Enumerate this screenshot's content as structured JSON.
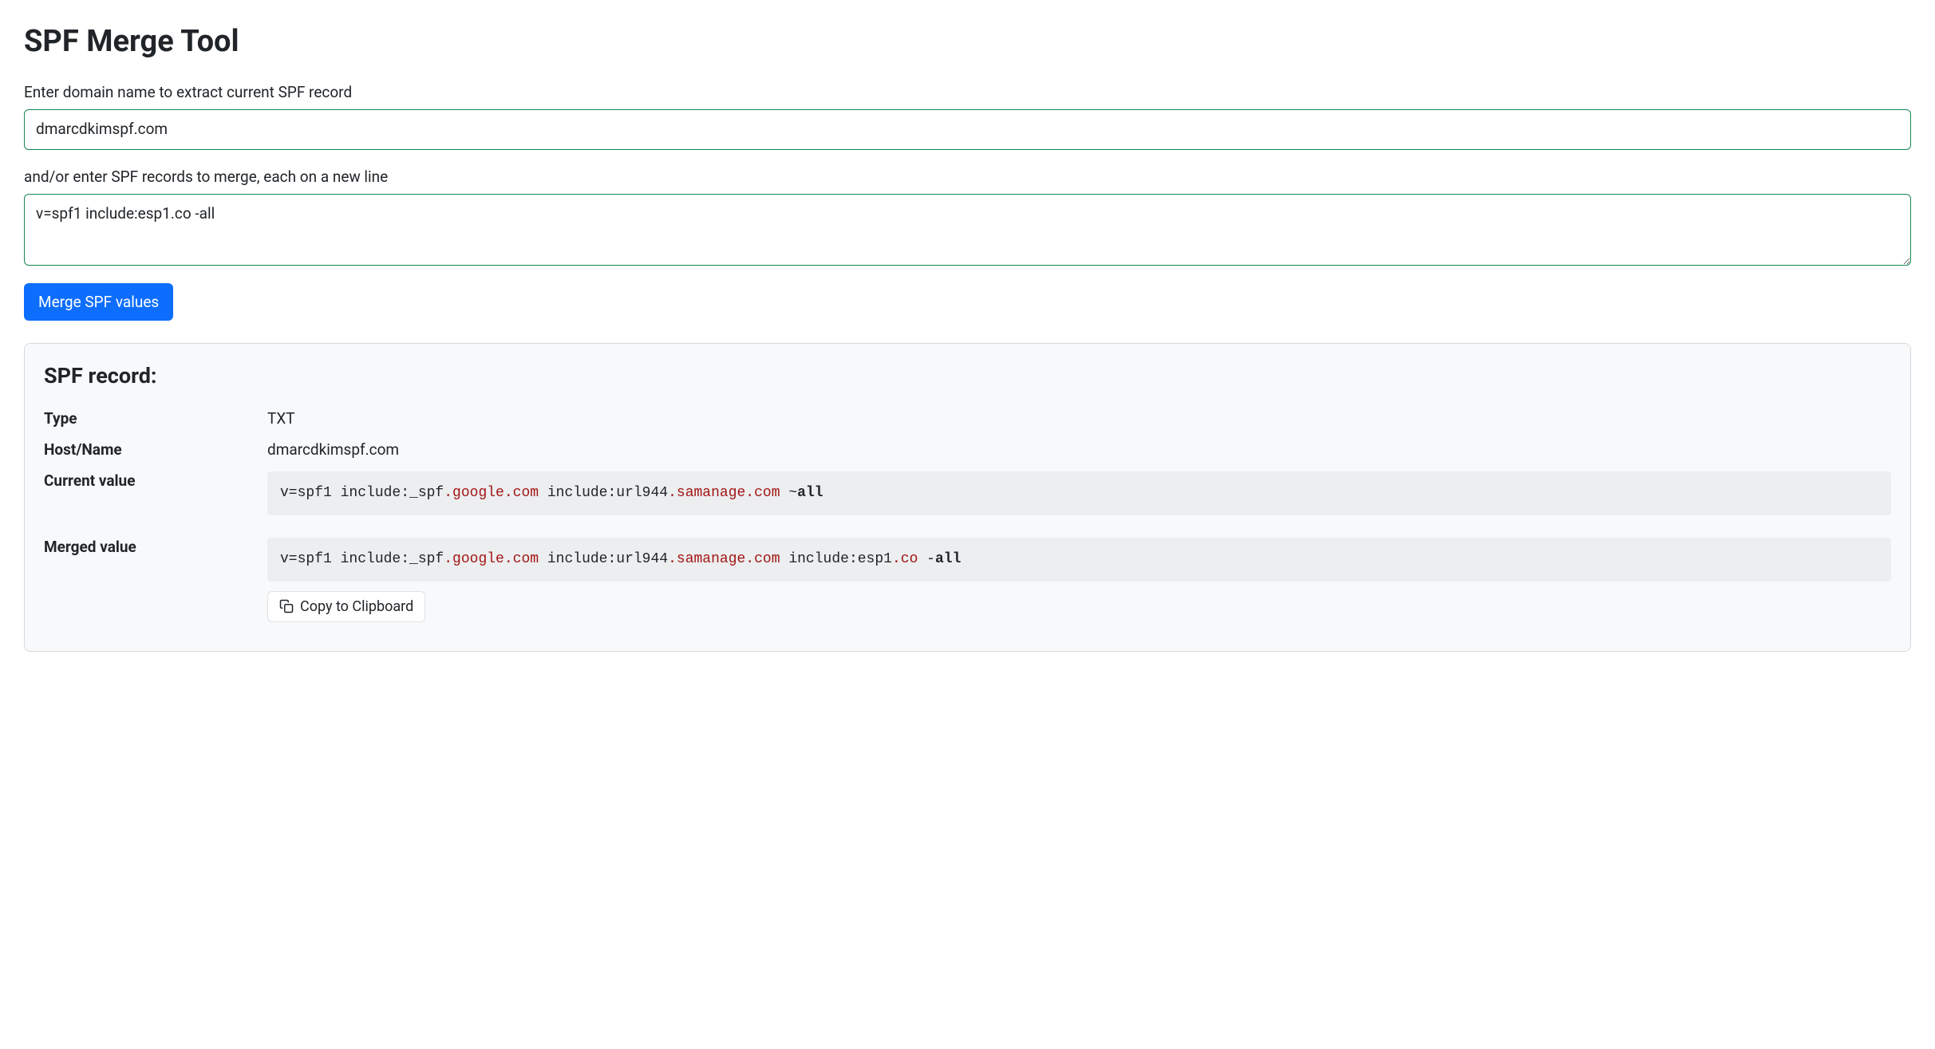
{
  "page": {
    "title": "SPF Merge Tool"
  },
  "form": {
    "domain_label": "Enter domain name to extract current SPF record",
    "domain_value": "dmarcdkimspf.com",
    "merge_label": "and/or enter SPF records to merge, each on a new line",
    "merge_value": "v=spf1 include:esp1.co -all",
    "submit_label": "Merge SPF values"
  },
  "result": {
    "heading": "SPF record:",
    "rows": {
      "type": {
        "label": "Type",
        "value": "TXT"
      },
      "host": {
        "label": "Host/Name",
        "value": "dmarcdkimspf.com"
      },
      "current": {
        "label": "Current value"
      },
      "merged": {
        "label": "Merged value"
      }
    },
    "current_tokens": [
      {
        "t": "v=spf1 include:_spf",
        "c": "default"
      },
      {
        "t": ".google.com",
        "c": "red"
      },
      {
        "t": " include:url944",
        "c": "default"
      },
      {
        "t": ".samanage.com",
        "c": "red"
      },
      {
        "t": " ~",
        "c": "default"
      },
      {
        "t": "all",
        "c": "bold"
      }
    ],
    "merged_tokens": [
      {
        "t": "v=spf1 include:_spf",
        "c": "default"
      },
      {
        "t": ".google.com",
        "c": "red"
      },
      {
        "t": " include:url944",
        "c": "default"
      },
      {
        "t": ".samanage.com",
        "c": "red"
      },
      {
        "t": " include:esp1",
        "c": "default"
      },
      {
        "t": ".co",
        "c": "red"
      },
      {
        "t": " -",
        "c": "default"
      },
      {
        "t": "all",
        "c": "bold"
      }
    ],
    "copy_label": "Copy to Clipboard"
  }
}
